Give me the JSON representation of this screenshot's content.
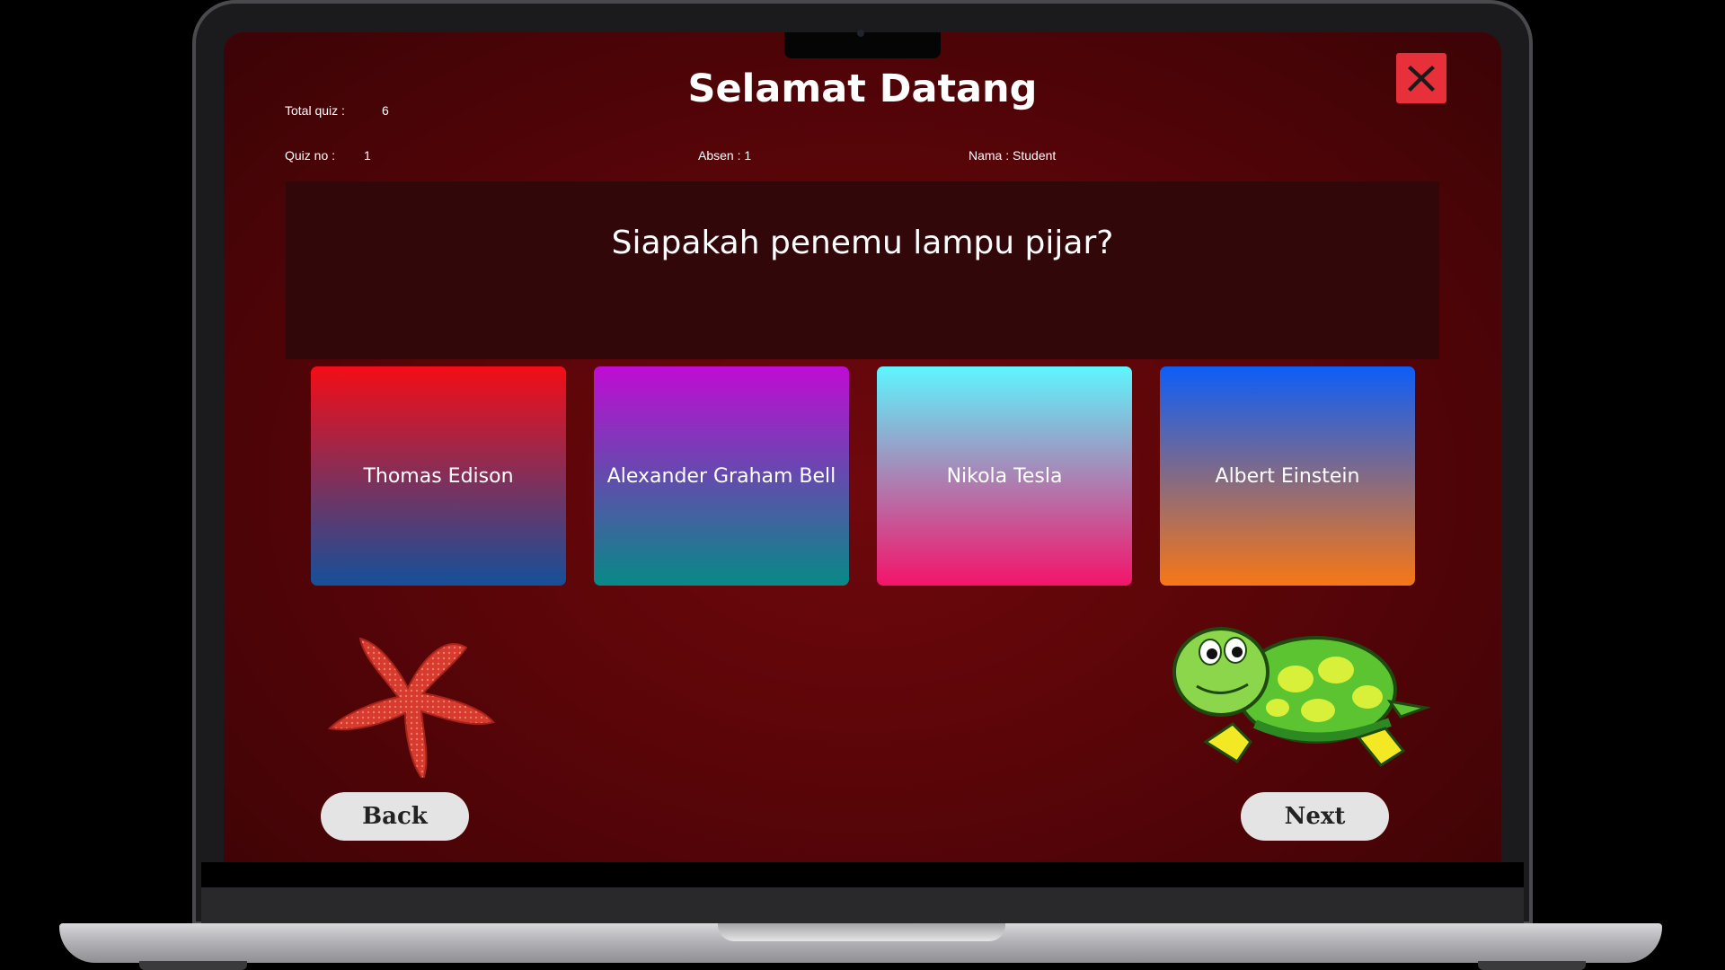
{
  "app": {
    "title": "Selamat Datang",
    "close_icon": "close-x-icon"
  },
  "info": {
    "total_quiz_label": "Total quiz :",
    "total_quiz_value": "6",
    "quiz_no_label": "Quiz no :",
    "quiz_no_value": "1",
    "absen": "Absen : 1",
    "nama": "Nama : Student"
  },
  "question": {
    "text": "Siapakah penemu lampu pijar?"
  },
  "answers": [
    {
      "label": "Thomas Edison"
    },
    {
      "label": "Alexander Graham Bell"
    },
    {
      "label": "Nikola Tesla"
    },
    {
      "label": "Albert Einstein"
    }
  ],
  "nav": {
    "back_label": "Back",
    "next_label": "Next"
  },
  "illustrations": {
    "left": "starfish",
    "right": "turtle"
  },
  "colors": {
    "close_button": "#e8303a",
    "background": "#5a0508"
  }
}
